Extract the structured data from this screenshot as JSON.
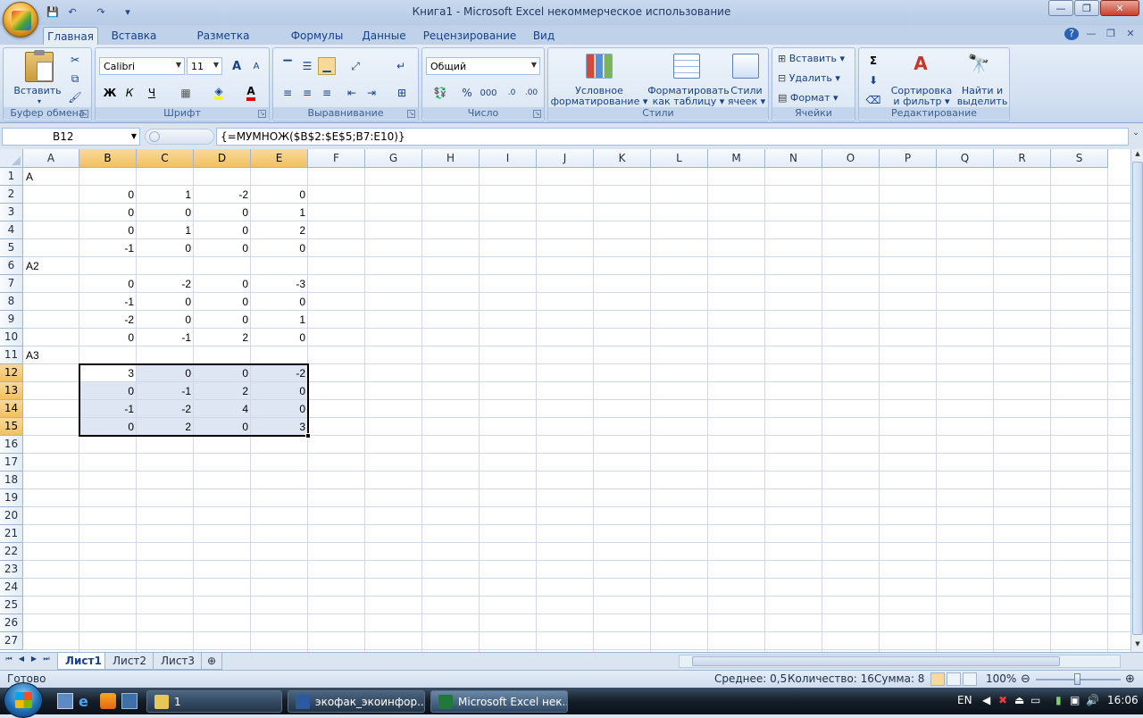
{
  "window": {
    "title": "Книга1 - Microsoft Excel некоммерческое использование"
  },
  "qat": {
    "save": "💾",
    "undo": "↶",
    "redo": "↷",
    "more": "▾"
  },
  "tabs": [
    "Главная",
    "Вставка",
    "Разметка страницы",
    "Формулы",
    "Данные",
    "Рецензирование",
    "Вид"
  ],
  "ribbon": {
    "clipboard": {
      "label": "Буфер обмена",
      "paste": "Вставить"
    },
    "font": {
      "label": "Шрифт",
      "name": "Calibri",
      "size": "11",
      "bold": "Ж",
      "italic": "К",
      "underline": "Ч",
      "grow": "A",
      "shrink": "A"
    },
    "alignment": {
      "label": "Выравнивание"
    },
    "number": {
      "label": "Число",
      "format": "Общий",
      "percent": "%",
      "thousands": "000"
    },
    "styles": {
      "label": "Стили",
      "conditional_l1": "Условное",
      "conditional_l2": "форматирование",
      "astable_l1": "Форматировать",
      "astable_l2": "как таблицу",
      "cellstyles_l1": "Стили",
      "cellstyles_l2": "ячеек"
    },
    "cells": {
      "label": "Ячейки",
      "insert": "Вставить",
      "delete": "Удалить",
      "format": "Формат"
    },
    "editing": {
      "label": "Редактирование",
      "sum": "Σ",
      "sort_l1": "Сортировка",
      "sort_l2": "и фильтр",
      "find_l1": "Найти и",
      "find_l2": "выделить"
    }
  },
  "formula_bar": {
    "name_box": "B12",
    "formula": "{=МУМНОЖ($B$2:$E$5;B7:E10)}"
  },
  "columns": [
    "A",
    "B",
    "C",
    "D",
    "E",
    "F",
    "G",
    "H",
    "I",
    "J",
    "K",
    "L",
    "M",
    "N",
    "O",
    "P",
    "Q",
    "R",
    "S"
  ],
  "rows": [
    "1",
    "2",
    "3",
    "4",
    "5",
    "6",
    "7",
    "8",
    "9",
    "10",
    "11",
    "12",
    "13",
    "14",
    "15",
    "16",
    "17",
    "18",
    "19",
    "20",
    "21",
    "22",
    "23",
    "24",
    "25",
    "26",
    "27"
  ],
  "cells": {
    "A1": "A",
    "B2": "0",
    "C2": "1",
    "D2": "-2",
    "E2": "0",
    "B3": "0",
    "C3": "0",
    "D3": "0",
    "E3": "1",
    "B4": "0",
    "C4": "1",
    "D4": "0",
    "E4": "2",
    "B5": "-1",
    "C5": "0",
    "D5": "0",
    "E5": "0",
    "A6": "A2",
    "B7": "0",
    "C7": "-2",
    "D7": "0",
    "E7": "-3",
    "B8": "-1",
    "C8": "0",
    "D8": "0",
    "E8": "0",
    "B9": "-2",
    "C9": "0",
    "D9": "0",
    "E9": "1",
    "B10": "0",
    "C10": "-1",
    "D10": "2",
    "E10": "0",
    "A11": "A3",
    "B12": "3",
    "C12": "0",
    "D12": "0",
    "E12": "-2",
    "B13": "0",
    "C13": "-1",
    "D13": "2",
    "E13": "0",
    "B14": "-1",
    "C14": "-2",
    "D14": "4",
    "E14": "0",
    "B15": "0",
    "C15": "2",
    "D15": "0",
    "E15": "3"
  },
  "selection": {
    "range": "B12:E15",
    "selected_columns": [
      "B",
      "C",
      "D",
      "E"
    ],
    "selected_rows": [
      "12",
      "13",
      "14",
      "15"
    ]
  },
  "sheets": [
    "Лист1",
    "Лист2",
    "Лист3"
  ],
  "active_sheet": "Лист1",
  "status": {
    "ready": "Готово",
    "average": "Среднее: 0,5",
    "count": "Количество: 16",
    "sum": "Сумма: 8",
    "zoom": "100%",
    "zoom_level": 1.0
  },
  "taskbar": {
    "tasks": [
      "1",
      "экофак_экоинфор...",
      "Microsoft Excel нек..."
    ],
    "lang": "EN",
    "time": "16:06"
  }
}
